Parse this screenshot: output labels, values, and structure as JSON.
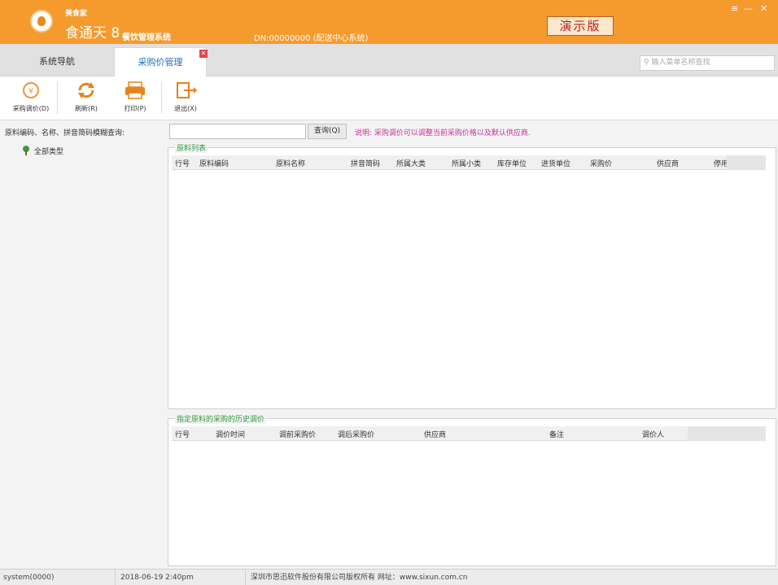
{
  "titlebar": {
    "brand_small": "美食家",
    "brand_name": "食通天 8",
    "brand_sub": "餐饮管理系统",
    "dn_info": "DN:00000000 (配送中心系统)",
    "demo_badge": "演示版",
    "minimize_glyph": "—",
    "close_glyph": "✕",
    "menu_glyph": "≡",
    "accent_color": "#f59b2e"
  },
  "tabs": {
    "nav_label": "系统导航",
    "active_label": "采购价管理",
    "close_glyph": "✕"
  },
  "search": {
    "placeholder": "输入菜单名称查找"
  },
  "toolbar": {
    "buttons": [
      {
        "label": "采购调价(D)",
        "icon": "price-adjust-icon"
      },
      {
        "label": "刷新(R)",
        "icon": "refresh-icon"
      },
      {
        "label": "打印(P)",
        "icon": "print-icon"
      },
      {
        "label": "退出(X)",
        "icon": "exit-icon"
      }
    ]
  },
  "query": {
    "label": "原料编码、名称、拼音简码模糊查询:",
    "value": "",
    "button": "查询(Q)",
    "note": "说明: 采购调价可以调整当前采购价格以及默认供应商."
  },
  "tree": {
    "root_label": "全部类型"
  },
  "materials_panel": {
    "title": "原料列表",
    "columns": [
      "行号",
      "原料编码",
      "原料名称",
      "拼音简码",
      "所属大类",
      "所属小类",
      "库存单位",
      "进货单位",
      "采购价",
      "供应商",
      "停用"
    ],
    "rows": []
  },
  "history_panel": {
    "title": "指定原料的采购的历史调价",
    "columns": [
      "行号",
      "调价时间",
      "调前采购价",
      "调后采购价",
      "供应商",
      "备注",
      "调价人"
    ],
    "rows": []
  },
  "statusbar": {
    "user": "system(0000)",
    "datetime": "2018-06-19 2:40pm",
    "copyright": "深圳市思迅软件股份有限公司版权所有 网址：www.sixun.com.cn"
  }
}
